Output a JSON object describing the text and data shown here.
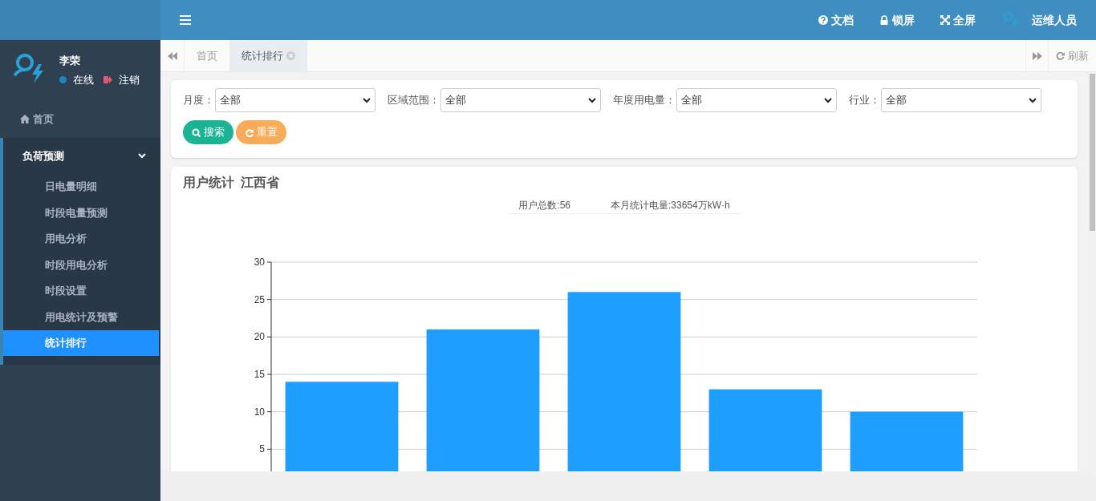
{
  "sidebar": {
    "user": {
      "name": "李荣",
      "status": "在线",
      "online": true,
      "logout": "注销"
    },
    "items": [
      {
        "label": "首页",
        "kind": "link",
        "selected": false
      },
      {
        "label": "负荷预测",
        "kind": "group",
        "expanded": true,
        "children": [
          {
            "label": "日电量明细",
            "selected": false
          },
          {
            "label": "时段电量预测",
            "selected": false
          },
          {
            "label": "用电分析",
            "selected": false
          },
          {
            "label": "时段用电分析",
            "selected": false
          },
          {
            "label": "时段设置",
            "selected": false
          },
          {
            "label": "用电统计及预警",
            "selected": false
          },
          {
            "label": "统计排行",
            "selected": true
          }
        ]
      }
    ]
  },
  "topbar": {
    "items": [
      {
        "label": "文档",
        "kind": "help"
      },
      {
        "label": "锁屏",
        "kind": "lock"
      },
      {
        "label": "全屏",
        "kind": "fullscreen"
      }
    ],
    "user": "运维人员"
  },
  "tabs": [
    {
      "label": "首页",
      "selected": false,
      "closable": false
    },
    {
      "label": "统计排行",
      "selected": true,
      "closable": true
    }
  ],
  "refresh": "刷新",
  "filters": [
    {
      "label": "月度：",
      "value": "全部"
    },
    {
      "label": "区域范围：",
      "value": "全部"
    },
    {
      "label": "年度用电量：",
      "value": "全部"
    },
    {
      "label": "行业：",
      "value": "全部"
    }
  ],
  "buttons": [
    {
      "label": "搜索",
      "kind": "search"
    },
    {
      "label": "重置",
      "kind": "reset"
    }
  ],
  "panel": {
    "title": "用户统计",
    "region": "江西省",
    "stats": [
      "用户总数:56",
      "本月统计电量:33654万kW·h"
    ],
    "chart_data": {
      "type": "bar",
      "grid": true,
      "values": [
        14,
        21,
        26,
        13,
        10
      ],
      "ylim": [
        0,
        30
      ],
      "yticks": [
        5,
        10,
        15,
        20,
        25,
        30
      ]
    }
  }
}
